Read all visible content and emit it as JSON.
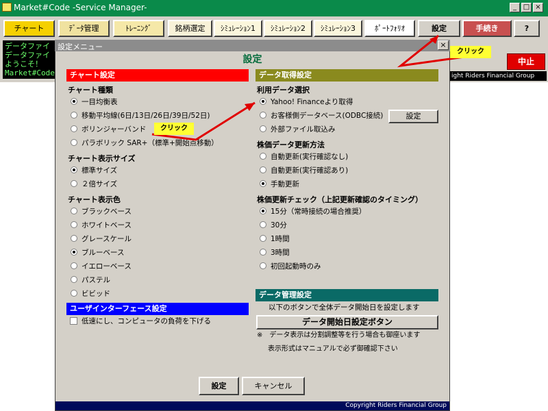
{
  "window": {
    "title": "Market#Code -Service Manager-",
    "minimize": "_",
    "maximize": "□",
    "close": "×"
  },
  "toolbar": [
    {
      "label": "チャート",
      "bg": "#f5d000"
    },
    {
      "label": "ﾃﾞｰﾀ管理",
      "bg": "#f0e2a0"
    },
    {
      "label": "ﾄﾚｰﾆﾝｸﾞ",
      "bg": "#f5e8a8"
    },
    {
      "label": "銘柄選定",
      "bg": "#f8f2d8"
    },
    {
      "label": "ｼﾐｭﾚｰｼｮﾝ1",
      "bg": "#fbf6dc"
    },
    {
      "label": "ｼﾐｭﾚｰｼｮﾝ2",
      "bg": "#fbf6dc"
    },
    {
      "label": "ｼﾐｭﾚｰｼｮﾝ3",
      "bg": "#fbf6dc"
    },
    {
      "label": "ﾎﾟｰﾄﾌｫﾘｵ",
      "bg": "#ffffff"
    },
    {
      "label": "設定",
      "bg": "#d4d0c8"
    },
    {
      "label": "手続き",
      "bg": "#c85050"
    },
    {
      "label": "?",
      "bg": "#d4d0c8"
    }
  ],
  "console": {
    "lines": [
      "データファイ",
      "データファイ",
      "ようこそ！",
      "Market#Code"
    ]
  },
  "abort_label": "中止",
  "copyright_top": "ight Riders Financial Group",
  "dialog": {
    "title": "設定メニュー",
    "close": "×",
    "header": "設定",
    "footer": "Copyright Riders Financial Group",
    "ok_label": "設定",
    "cancel_label": "キャンセル"
  },
  "chart_settings": {
    "section": "チャート設定",
    "section_color": "#ff0000",
    "type": {
      "label": "チャート種類",
      "options": [
        "一目均衡表",
        "移動平均線(6日/13日/26日/39日/52日)",
        "ボリンジャーバンド",
        "パラボリック SAR+（標準+開始点移動）"
      ],
      "selected": 0
    },
    "size": {
      "label": "チャート表示サイズ",
      "options": [
        "標準サイズ",
        "２倍サイズ"
      ],
      "selected": 0
    },
    "color": {
      "label": "チャート表示色",
      "options": [
        "ブラックベース",
        "ホワイトベース",
        "グレースケール",
        "ブルーベース",
        "イエローベース",
        "パステル",
        "ビビッド"
      ],
      "selected": 3
    }
  },
  "ui_settings": {
    "section": "ユーザインターフェース設定",
    "section_color": "#0000ff",
    "low_speed_label": "低速にし、コンピュータの負荷を下げる",
    "low_speed_checked": false
  },
  "data_settings": {
    "section": "データ取得設定",
    "section_color": "#8a8a1e",
    "source": {
      "label": "利用データ選択",
      "options": [
        "Yahoo! Financeより取得",
        "お客様側データベース(ODBC接続)",
        "外部ファイル取込み"
      ],
      "selected": 0,
      "setting_button": "設定"
    },
    "update": {
      "label": "株価データ更新方法",
      "options": [
        "自動更新(実行確認なし)",
        "自動更新(実行確認あり)",
        "手動更新"
      ],
      "selected": 2
    },
    "check": {
      "label": "株価更新チェック（上記更新確認のタイミング）",
      "options": [
        "15分（常時接続の場合推奨）",
        "30分",
        "1時間",
        "3時間",
        "初回起動時のみ"
      ],
      "selected": 0
    }
  },
  "data_mgmt": {
    "section": "データ管理設定",
    "section_color": "#0a6a66",
    "description": "以下のボタンで全体データ開始日を設定します",
    "button": "データ開始日設定ボタン",
    "note1": "※　データ表示は分割調整等を行う場合も御座います",
    "note2": "表示形式はマニュアルで必ず御確認下さい"
  },
  "callouts": {
    "top": "クリック",
    "middle": "クリック"
  },
  "colors": {
    "titlebar": "#0a8a4a",
    "callout": "#ffff33",
    "arrow": "#e00000"
  }
}
